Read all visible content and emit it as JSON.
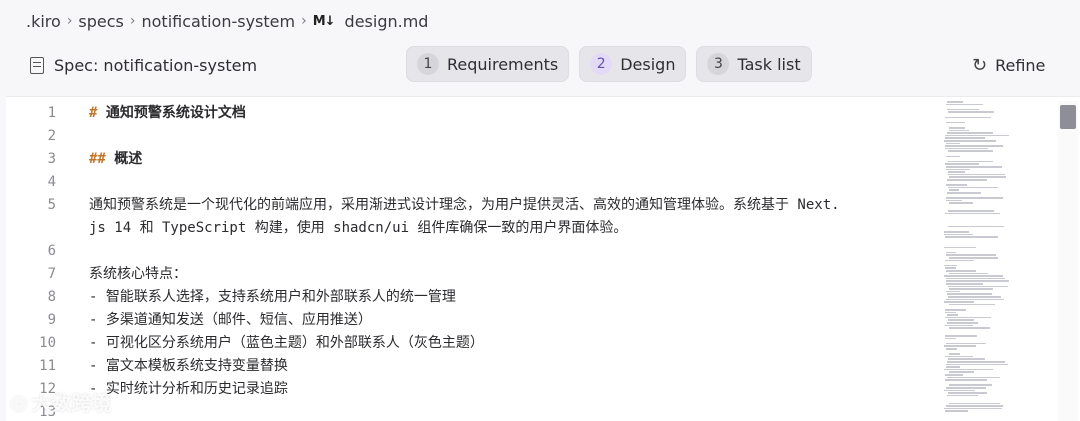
{
  "breadcrumb": {
    "items": [
      ".kiro",
      "specs",
      "notification-system",
      "design.md"
    ],
    "file_icon": "markdown-icon",
    "file_icon_text": "M↓"
  },
  "header": {
    "spec_title": "Spec: notification-system",
    "tabs": [
      {
        "num": "1",
        "label": "Requirements"
      },
      {
        "num": "2",
        "label": "Design"
      },
      {
        "num": "3",
        "label": "Task list"
      }
    ],
    "active_tab": "Design",
    "refine_label": "Refine"
  },
  "editor": {
    "lines": [
      {
        "n": "1",
        "text": "通知预警系统设计文档",
        "marker": "#"
      },
      {
        "n": "2",
        "text": ""
      },
      {
        "n": "3",
        "text": "概述",
        "marker": "##"
      },
      {
        "n": "4",
        "text": ""
      },
      {
        "n": "5",
        "text": "通知预警系统是一个现代化的前端应用，采用渐进式设计理念，为用户提供灵活、高效的通知管理体验。系统基于 Next."
      },
      {
        "n": "",
        "text": "js 14 和 TypeScript 构建，使用 shadcn/ui 组件库确保一致的用户界面体验。"
      },
      {
        "n": "6",
        "text": ""
      },
      {
        "n": "7",
        "text": "系统核心特点："
      },
      {
        "n": "8",
        "text": "- 智能联系人选择，支持系统用户和外部联系人的统一管理"
      },
      {
        "n": "9",
        "text": "- 多渠道通知发送（邮件、短信、应用推送）"
      },
      {
        "n": "10",
        "text": "- 可视化区分系统用户（蓝色主题）和外部联系人（灰色主题）"
      },
      {
        "n": "11",
        "text": "- 富文本模板系统支持变量替换"
      },
      {
        "n": "12",
        "text": "- 实时统计分析和历史记录追踪"
      },
      {
        "n": "13",
        "text": ""
      }
    ]
  },
  "watermark": "大数跨境",
  "colors": {
    "accent": "#6a4fb3",
    "heading_marker": "#c0762a"
  }
}
